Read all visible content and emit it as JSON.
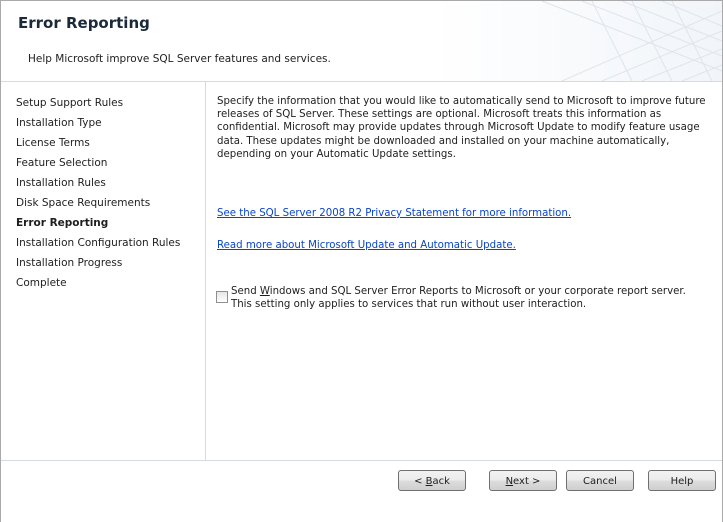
{
  "header": {
    "title": "Error Reporting",
    "subtitle": "Help Microsoft improve SQL Server features and services."
  },
  "sidebar": {
    "items": [
      {
        "label": "Setup Support Rules",
        "active": false
      },
      {
        "label": "Installation Type",
        "active": false
      },
      {
        "label": "License Terms",
        "active": false
      },
      {
        "label": "Feature Selection",
        "active": false
      },
      {
        "label": "Installation Rules",
        "active": false
      },
      {
        "label": "Disk Space Requirements",
        "active": false
      },
      {
        "label": "Error Reporting",
        "active": true
      },
      {
        "label": "Installation Configuration Rules",
        "active": false
      },
      {
        "label": "Installation Progress",
        "active": false
      },
      {
        "label": "Complete",
        "active": false
      }
    ]
  },
  "main": {
    "description": "Specify the information that you would like to automatically send to Microsoft to improve future releases of SQL Server. These settings are optional. Microsoft treats this information as confidential. Microsoft may provide updates through Microsoft Update to modify feature usage data. These updates might be downloaded and installed on your machine automatically, depending on your Automatic Update settings.",
    "privacy_link": "See the SQL Server 2008 R2 Privacy Statement for more information.",
    "update_link": "Read more about Microsoft Update and Automatic Update.",
    "checkbox": {
      "prefix": "Send ",
      "accel": "W",
      "rest": "indows and SQL Server Error Reports to Microsoft or your corporate report server. This setting only applies to services that run without user interaction.",
      "checked": false
    }
  },
  "buttons": {
    "back": {
      "pre": "< ",
      "accel": "B",
      "post": "ack"
    },
    "next": {
      "pre": "",
      "accel": "N",
      "post": "ext >"
    },
    "cancel": "Cancel",
    "help": "Help"
  },
  "colors": {
    "link": "#0a44c8",
    "divider": "#d6dbe1"
  }
}
